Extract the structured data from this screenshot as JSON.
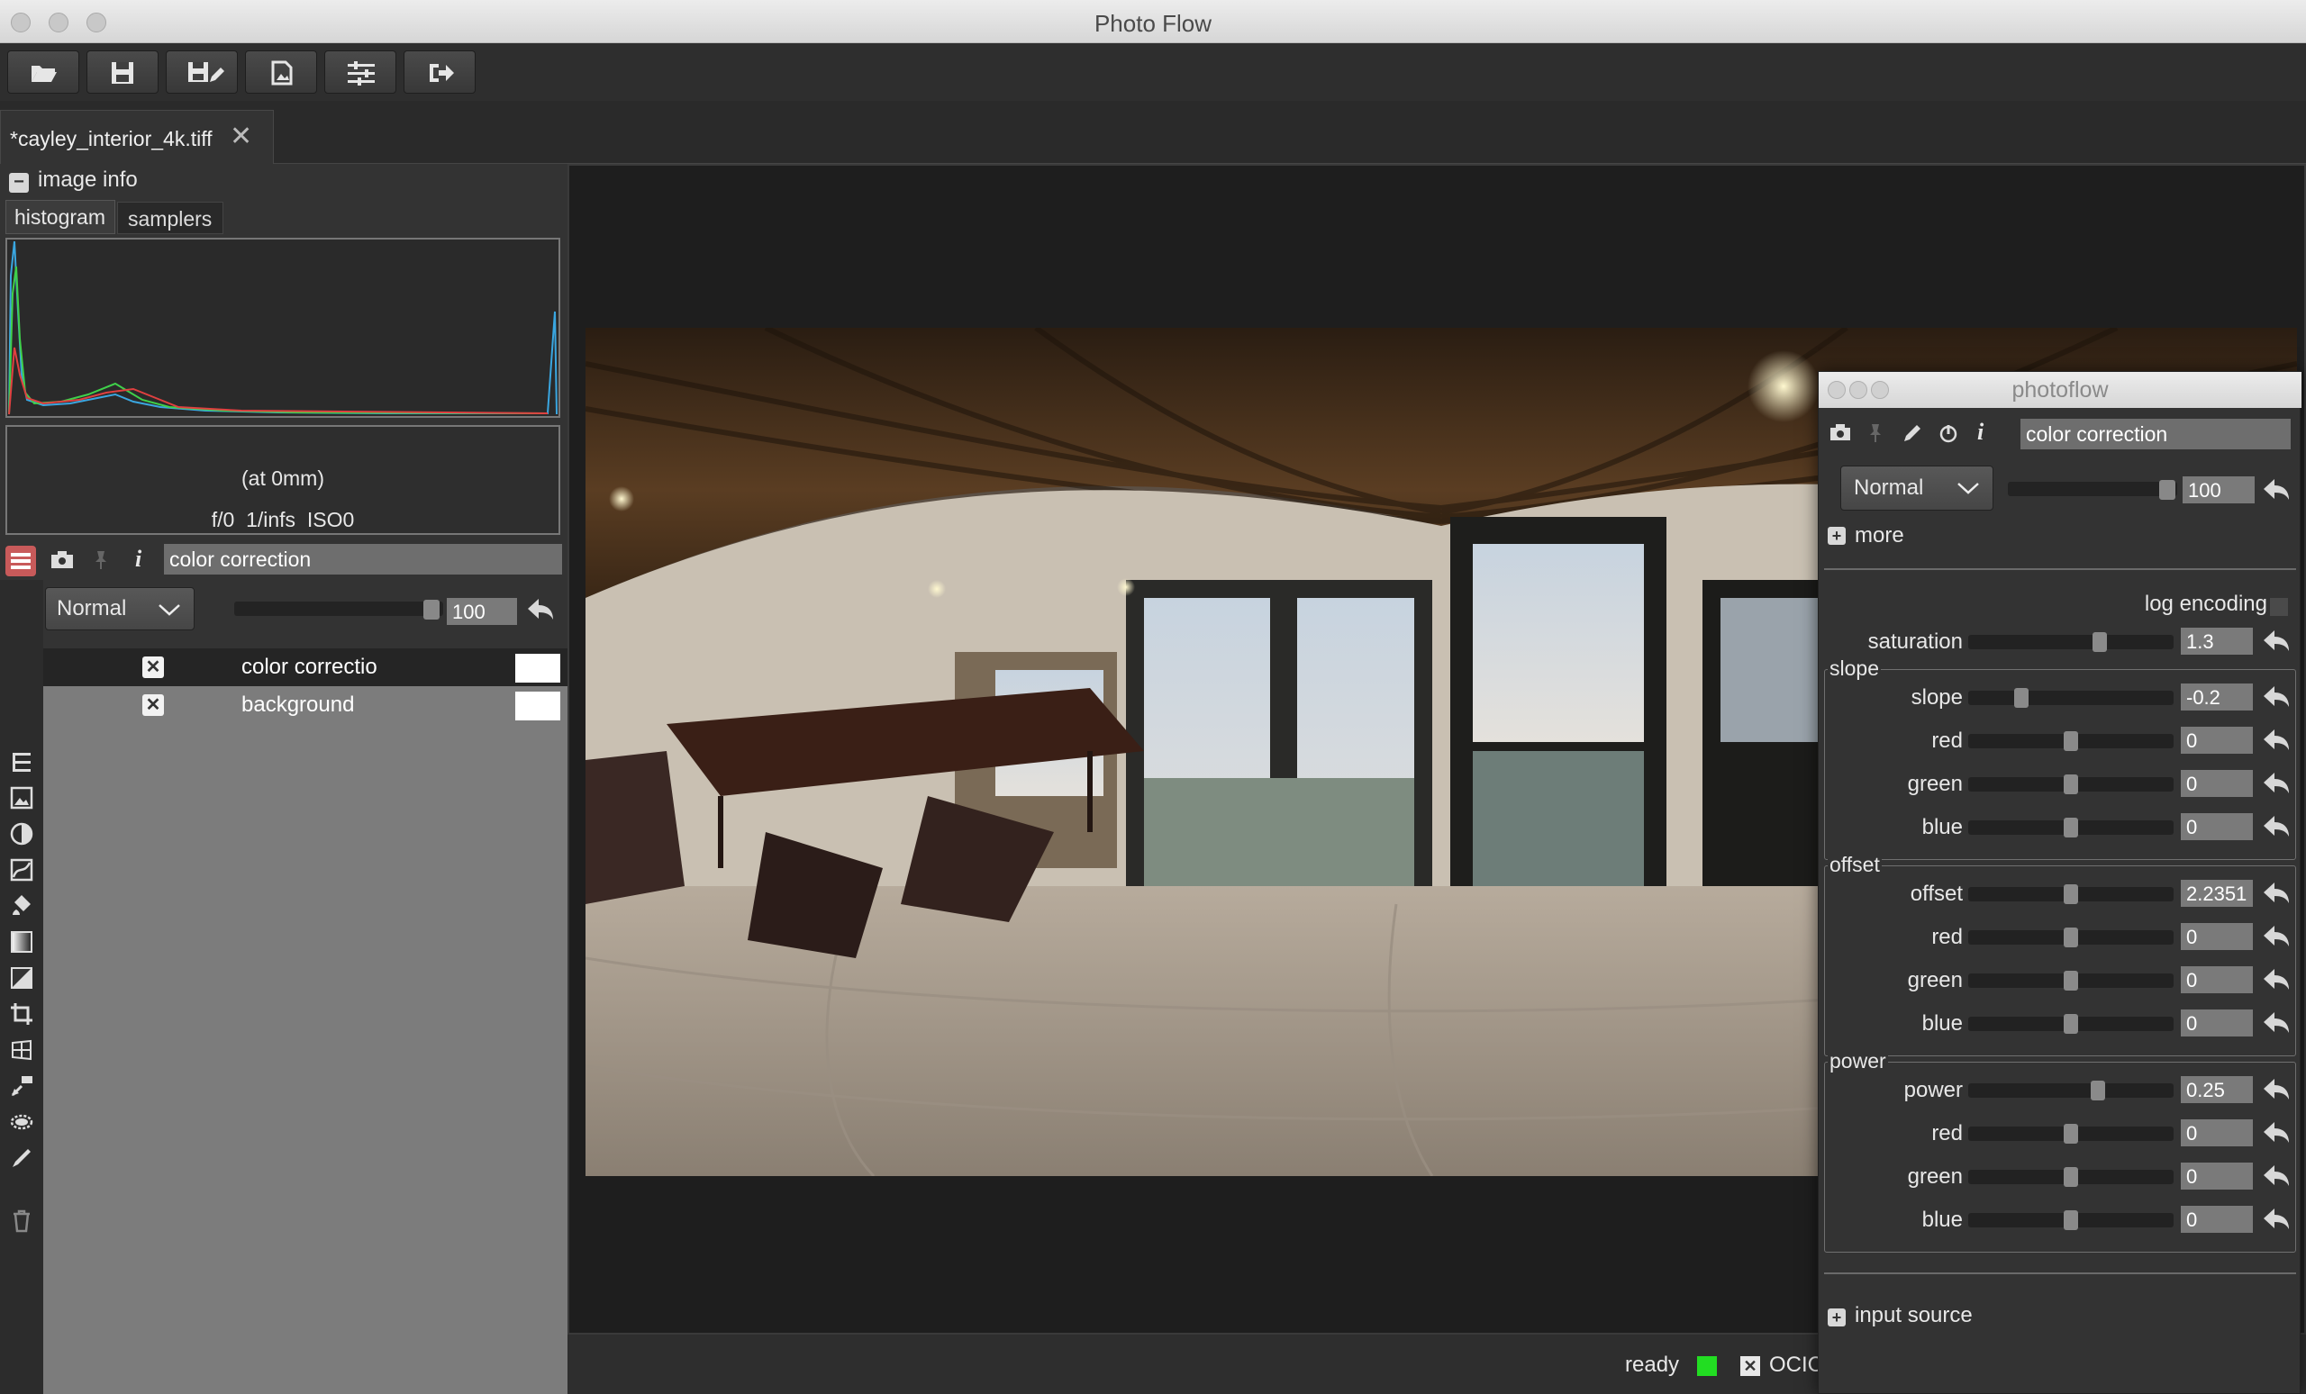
{
  "window": {
    "title": "Photo Flow"
  },
  "toolbar": {
    "buttons": [
      "open-icon",
      "save-icon",
      "save-as-icon",
      "export-icon",
      "settings-icon",
      "exit-icon"
    ]
  },
  "tabs": {
    "file": "*cayley_interior_4k.tiff",
    "close": "✕"
  },
  "image_info": {
    "toggle": "−",
    "label": "image info",
    "tabs": {
      "histogram": "histogram",
      "samplers": "samplers"
    },
    "focal": "(at 0mm)",
    "exposure": "f/0  1/infs  ISO0"
  },
  "layers": {
    "info_glyph": "i",
    "selected_name": "color correction",
    "blend_mode": "Normal",
    "opacity": "100",
    "opacity_fraction": 1.0,
    "rows": [
      {
        "name": "color correctio",
        "check": "✕"
      },
      {
        "name": "background",
        "check": "✕"
      }
    ]
  },
  "status": {
    "text": "ready",
    "led_color": "#22dd22",
    "ocio_check": "✕",
    "ocio_label": "OCIC"
  },
  "dialog": {
    "title": "photoflow",
    "info_glyph": "i",
    "layer_name": "color correction",
    "blend_mode": "Normal",
    "opacity": "100",
    "more_toggle": "+",
    "more_label": "more",
    "log_encoding_label": "log encoding",
    "saturation": {
      "label": "saturation",
      "value": "1.3",
      "fraction": 0.65
    },
    "groups": [
      {
        "title": "slope",
        "params": [
          {
            "label": "slope",
            "value": "-0.2",
            "fraction": 0.24
          },
          {
            "label": "red",
            "value": "0",
            "fraction": 0.5
          },
          {
            "label": "green",
            "value": "0",
            "fraction": 0.5
          },
          {
            "label": "blue",
            "value": "0",
            "fraction": 0.5
          }
        ]
      },
      {
        "title": "offset",
        "params": [
          {
            "label": "offset",
            "value": "2.2351",
            "fraction": 0.5
          },
          {
            "label": "red",
            "value": "0",
            "fraction": 0.5
          },
          {
            "label": "green",
            "value": "0",
            "fraction": 0.5
          },
          {
            "label": "blue",
            "value": "0",
            "fraction": 0.5
          }
        ]
      },
      {
        "title": "power",
        "params": [
          {
            "label": "power",
            "value": "0.25",
            "fraction": 0.64
          },
          {
            "label": "red",
            "value": "0",
            "fraction": 0.5
          },
          {
            "label": "green",
            "value": "0",
            "fraction": 0.5
          },
          {
            "label": "blue",
            "value": "0",
            "fraction": 0.5
          }
        ]
      }
    ],
    "input_toggle": "+",
    "input_source_label": "input source"
  }
}
